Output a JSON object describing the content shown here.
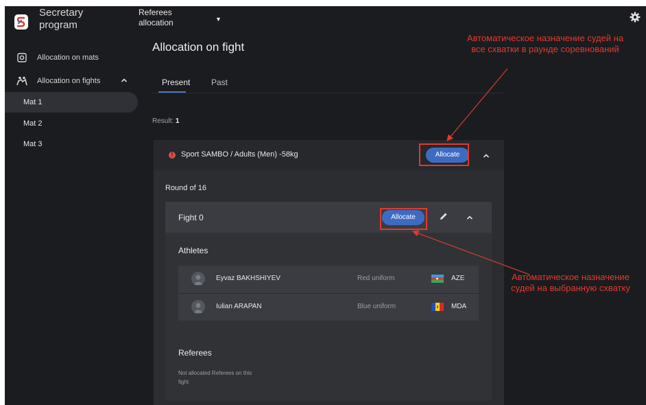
{
  "brand": {
    "name": "Secretary program"
  },
  "header": {
    "section": "Referees allocation",
    "page_title": "Allocation on fight"
  },
  "sidebar": {
    "items": [
      {
        "label": "Allocation on mats",
        "icon": "mat-icon"
      },
      {
        "label": "Allocation on fights",
        "icon": "fighters-icon"
      }
    ],
    "mats": [
      "Mat 1",
      "Mat 2",
      "Mat 3"
    ],
    "active_mat": "Mat 1"
  },
  "tabs": [
    "Present",
    "Past"
  ],
  "active_tab": "Present",
  "result": {
    "label": "Result:",
    "count": "1"
  },
  "category": {
    "name": "Sport SAMBO / Adults (Men) -58kg",
    "allocate_label": "Allocate",
    "round": "Round of 16"
  },
  "fight": {
    "name": "Fight 0",
    "allocate_label": "Allocate",
    "athletes_title": "Athletes",
    "athletes": [
      {
        "name": "Eyvaz BAKHSHIYEV",
        "uniform": "Red uniform",
        "country": "AZE",
        "flag": "azerbaijan-flag-icon"
      },
      {
        "name": "Iulian ARAPAN",
        "uniform": "Blue uniform",
        "country": "MDA",
        "flag": "moldova-flag-icon"
      }
    ],
    "referees_title": "Referees",
    "referees_note": "Not allocated Referees on this fight"
  },
  "annotations": {
    "top": "Автоматическое назначение судей на все схватки в раунде соревнований",
    "right": "Автоматическое назначение судей на выбранную схватку"
  },
  "colors": {
    "accent": "#3e6bc2",
    "annotation": "#e03a2f",
    "background": "#1b1c1f"
  }
}
